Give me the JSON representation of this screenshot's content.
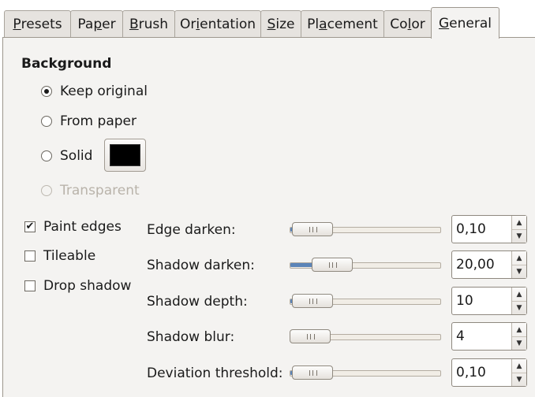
{
  "tabs": [
    {
      "pre": "",
      "mn": "P",
      "post": "resets"
    },
    {
      "pre": "Pa",
      "mn": "p",
      "post": "er"
    },
    {
      "pre": "",
      "mn": "B",
      "post": "rush"
    },
    {
      "pre": "Or",
      "mn": "i",
      "post": "entation"
    },
    {
      "pre": "",
      "mn": "S",
      "post": "ize"
    },
    {
      "pre": "Pl",
      "mn": "a",
      "post": "cement"
    },
    {
      "pre": "Co",
      "mn": "l",
      "post": "or"
    },
    {
      "pre": "",
      "mn": "G",
      "post": "eneral"
    }
  ],
  "active_tab": "General",
  "background": {
    "heading": "Background",
    "options": [
      "Keep original",
      "From paper",
      "Solid",
      "Transparent"
    ],
    "selected": "Keep original",
    "solid_color": "#000000"
  },
  "checks": [
    {
      "label": "Paint edges",
      "checked": true
    },
    {
      "label": "Tileable",
      "checked": false
    },
    {
      "label": "Drop shadow",
      "checked": false
    }
  ],
  "sliders": [
    {
      "label": "Edge darken:",
      "value": "0,10",
      "fraction": 0.02
    },
    {
      "label": "Shadow darken:",
      "value": "20,00",
      "fraction": 0.2
    },
    {
      "label": "Shadow depth:",
      "value": "10",
      "fraction": 0.02
    },
    {
      "label": "Shadow blur:",
      "value": "4",
      "fraction": 0.0
    },
    {
      "label": "Deviation threshold:",
      "value": "0,10",
      "fraction": 0.02
    }
  ],
  "icons": {
    "spin_up": "▲",
    "spin_down": "▼",
    "check": "✔"
  },
  "colors": {
    "accent": "#5b84b8",
    "panel": "#f4f3f1",
    "tab": "#e6e3df"
  }
}
